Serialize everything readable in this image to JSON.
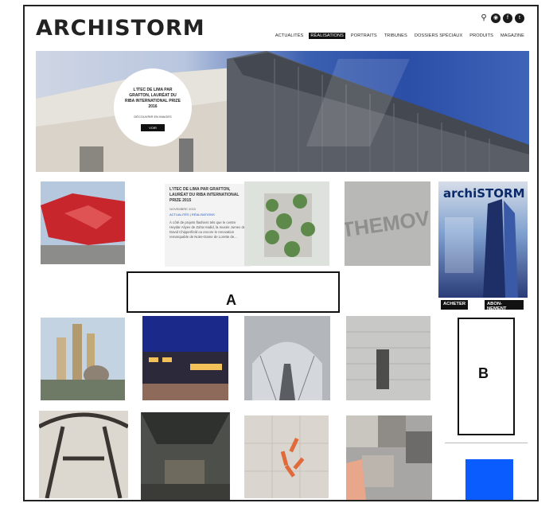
{
  "header": {
    "logo": "ARCHISTORM",
    "icons": [
      "search-icon",
      "instagram-icon",
      "facebook-icon",
      "twitter-icon"
    ],
    "nav": [
      "ACTUALITÉS",
      "RÉALISATIONS",
      "PORTRAITS",
      "TRIBUNES",
      "DOSSIERS SPÉCIAUX",
      "PRODUITS",
      "MAGAZINE"
    ],
    "active_nav": "RÉALISATIONS"
  },
  "hero": {
    "title": "L'ITEC DE LIMA PAR GRAFTON, LAURÉAT DU RIBA INTERNATIONAL PRIZE 2016",
    "subtitle": "DÉCOUVRIR EN IMAGES",
    "button": "VOIR"
  },
  "feature": {
    "title": "L'ITEC DE LIMA PAR GRAFTON, LAURÉAT DU RIBA INTERNATIONAL PRIZE 2015",
    "date": "NOVEMBRE 2015",
    "category": "ACTUALITÉS | RÉALISATIONS",
    "body": "À côté de projets flashiers tels que le centre Heydar Aliyev de Zaha Hadid, la musée Jumex de David Chipperfield ou encore le renovation remarquable de Notre-Dame de Lorette de..."
  },
  "magazine": {
    "name": "archiSTORM",
    "buy": "ACHETER",
    "subscribe": "ABON-\nNEMENT"
  },
  "annotations": {
    "a": "A",
    "b": "B"
  },
  "colors": {
    "accent": "#0b5cff",
    "nav_active": "#111111"
  }
}
